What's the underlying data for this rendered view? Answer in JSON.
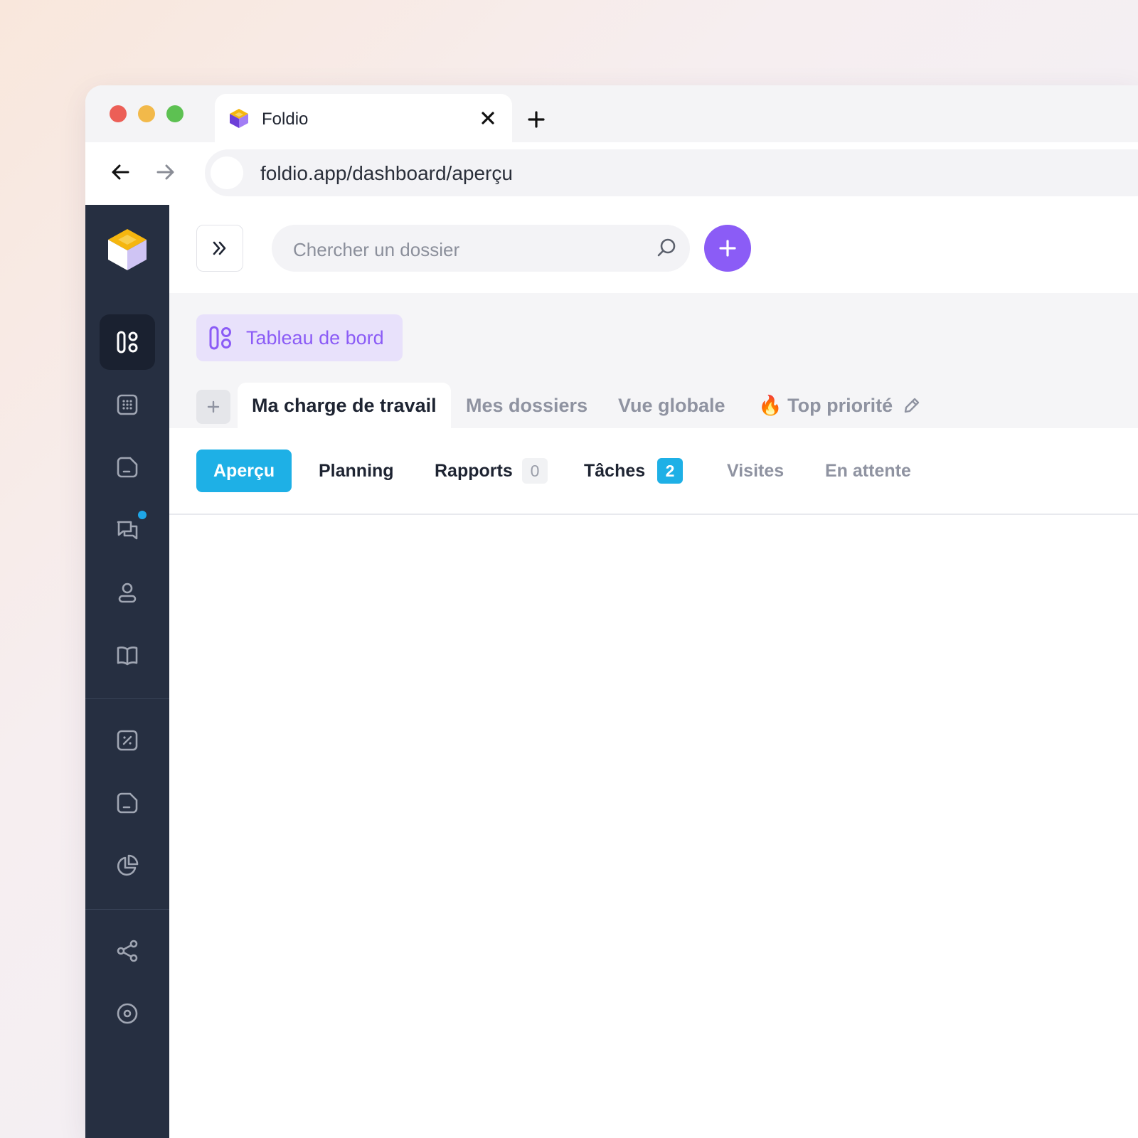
{
  "browser": {
    "tab_title": "Foldio",
    "url": "foldio.app/dashboard/aperçu"
  },
  "sidebar": {
    "items": [
      {
        "icon": "dashboard-icon",
        "active": true
      },
      {
        "icon": "calculator-icon"
      },
      {
        "icon": "document-icon"
      },
      {
        "icon": "chat-icon",
        "badge": true
      },
      {
        "icon": "user-icon"
      },
      {
        "icon": "book-icon"
      },
      {
        "icon": "percent-icon"
      },
      {
        "icon": "invoice-icon"
      },
      {
        "icon": "pie-chart-icon"
      },
      {
        "icon": "share-icon"
      },
      {
        "icon": "settings-icon"
      }
    ]
  },
  "topbar": {
    "search_placeholder": "Chercher un dossier"
  },
  "dashboard": {
    "title": "Tableau de bord"
  },
  "workspace_tabs": [
    {
      "label": "Ma charge de travail",
      "active": true
    },
    {
      "label": "Mes dossiers"
    },
    {
      "label": "Vue globale"
    },
    {
      "label": "🔥 Top priorité"
    }
  ],
  "subtabs": [
    {
      "label": "Aperçu",
      "active": true
    },
    {
      "label": "Planning"
    },
    {
      "label": "Rapports",
      "count": "0"
    },
    {
      "label": "Tâches",
      "count": "2"
    },
    {
      "label": "Visites"
    },
    {
      "label": "En attente"
    }
  ],
  "colors": {
    "accent_purple": "#8b5cf6",
    "accent_blue": "#1eb0e6",
    "sidebar_bg": "#262f41"
  }
}
